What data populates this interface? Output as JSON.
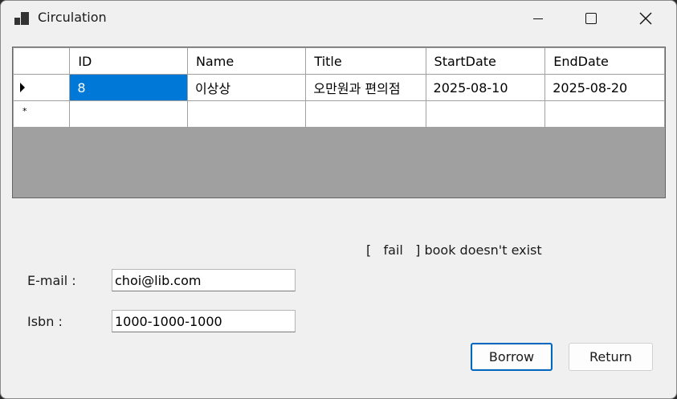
{
  "window": {
    "title": "Circulation",
    "controls": {
      "minimize": "minimize",
      "maximize": "maximize",
      "close": "✕"
    }
  },
  "grid": {
    "columns": [
      "",
      "ID",
      "Name",
      "Title",
      "StartDate",
      "EndDate"
    ],
    "rows": [
      {
        "marker": "current-row-arrow",
        "cells": [
          "8",
          "이상상",
          "오만원과 편의점",
          "2025-08-10",
          "2025-08-20"
        ]
      },
      {
        "marker": "new-row-asterisk",
        "new_marker": "*",
        "cells": [
          "",
          "",
          "",
          "",
          ""
        ]
      }
    ],
    "selected_cell_color": "#0078d7",
    "background_color": "#a0a0a0"
  },
  "status": {
    "open": "[",
    "result": "fail",
    "close": "]",
    "message": "book doesn't exist"
  },
  "form": {
    "email_label": "E-mail :",
    "email_value": "choi@lib.com",
    "isbn_label": "Isbn :",
    "isbn_value": "1000-1000-1000"
  },
  "buttons": {
    "borrow": "Borrow",
    "return": "Return"
  }
}
